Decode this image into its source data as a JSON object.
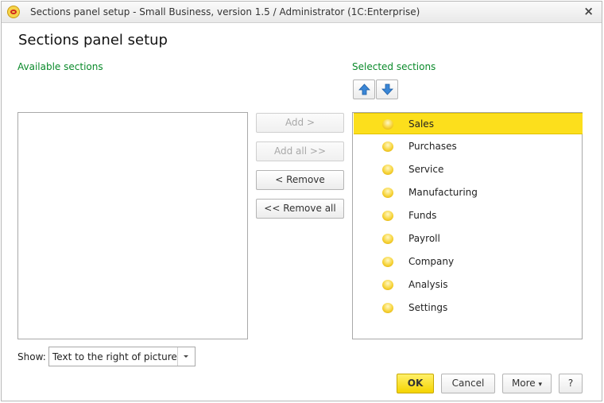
{
  "window": {
    "title": "Sections panel setup - Small Business, version 1.5 / Administrator  (1C:Enterprise)",
    "close_symbol": "×"
  },
  "heading": "Sections panel setup",
  "available": {
    "label": "Available sections",
    "items": []
  },
  "selected": {
    "label": "Selected sections",
    "move_up_icon": "arrow-up-icon",
    "move_down_icon": "arrow-down-icon",
    "items": [
      {
        "label": "Sales",
        "selected": true
      },
      {
        "label": "Purchases",
        "selected": false
      },
      {
        "label": "Service",
        "selected": false
      },
      {
        "label": "Manufacturing",
        "selected": false
      },
      {
        "label": "Funds",
        "selected": false
      },
      {
        "label": "Payroll",
        "selected": false
      },
      {
        "label": "Company",
        "selected": false
      },
      {
        "label": "Analysis",
        "selected": false
      },
      {
        "label": "Settings",
        "selected": false
      }
    ]
  },
  "transfer": {
    "add": "Add >",
    "add_all": "Add all >>",
    "remove": "< Remove",
    "remove_all": "<< Remove all"
  },
  "show": {
    "label": "Show:",
    "value": "Text to the right of picture"
  },
  "footer": {
    "ok": "OK",
    "cancel": "Cancel",
    "more": "More",
    "more_arrow": "▾",
    "help": "?"
  },
  "colors": {
    "accent_green": "#0a8a2a",
    "selection_yellow": "#fcdf1c",
    "arrow_blue": "#3a86d6"
  }
}
